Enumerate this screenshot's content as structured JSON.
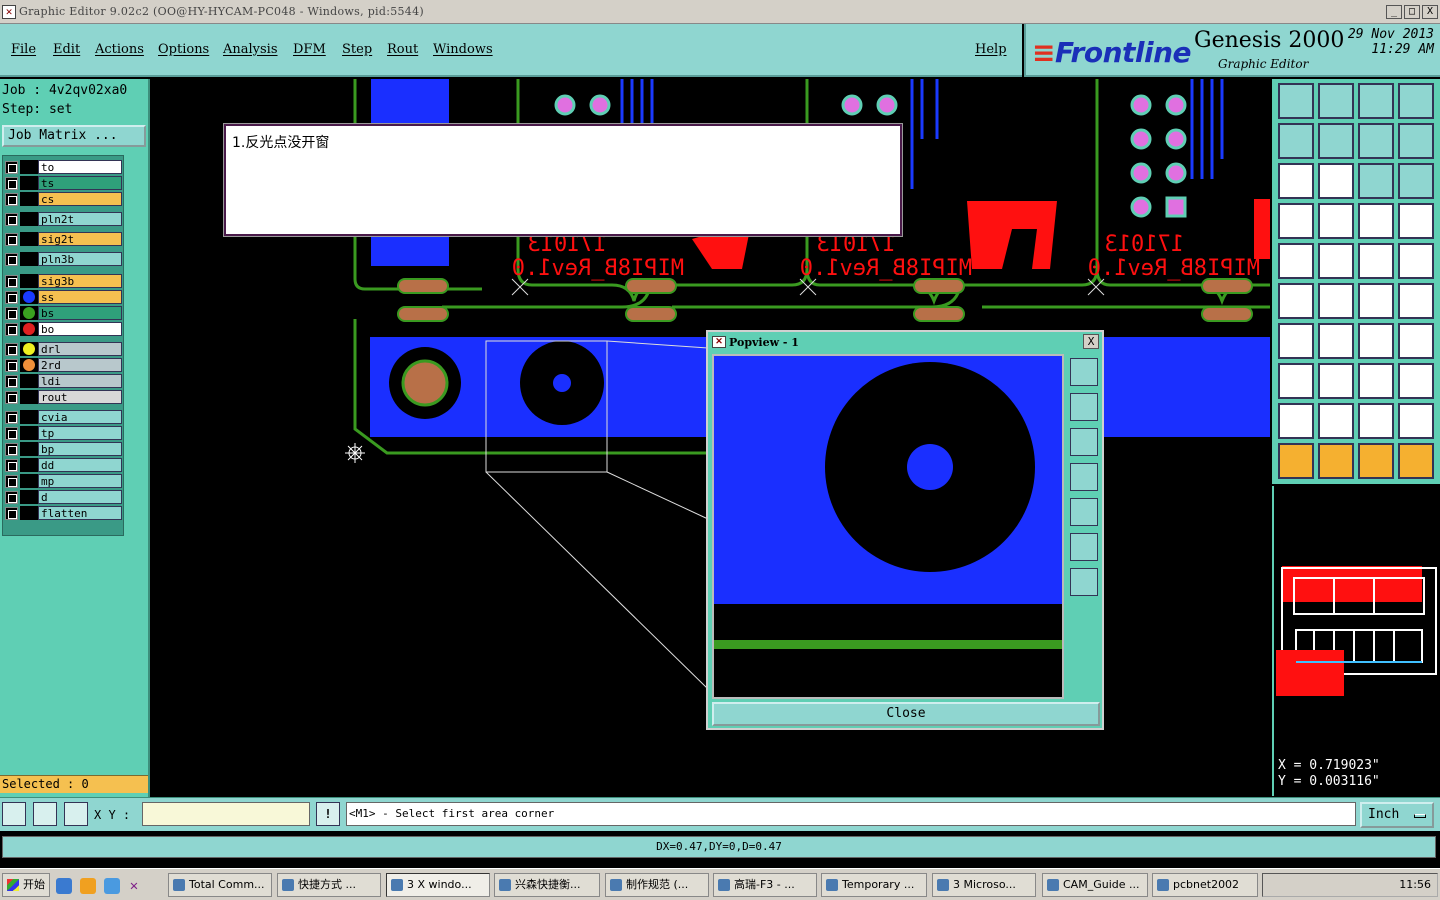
{
  "window": {
    "title": "Graphic Editor 9.02c2 (OO@HY-HYCAM-PC048 - Windows, pid:5544)",
    "minimize": "_",
    "maximize": "□",
    "close": "X"
  },
  "menu": {
    "file": "File",
    "edit": "Edit",
    "actions": "Actions",
    "options": "Options",
    "analysis": "Analysis",
    "dfm": "DFM",
    "step": "Step",
    "rout": "Rout",
    "windows": "Windows",
    "help": "Help"
  },
  "logo": {
    "brand": "Frontline",
    "product": "Genesis 2000",
    "subtitle": "Graphic Editor",
    "date": "29 Nov 2013",
    "time": "11:29 AM"
  },
  "job": {
    "job_line": "Job : 4v2qv02xa0",
    "step_line": "Step: set",
    "matrix_button": "Job Matrix ..."
  },
  "layers": [
    {
      "name": "to",
      "color": "#ffffff",
      "dot": ""
    },
    {
      "name": "ts",
      "color": "#2fa07a",
      "dot": ""
    },
    {
      "name": "cs",
      "color": "#f5c050",
      "dot": ""
    },
    {
      "name": "pln2t",
      "color": "#8fd6d0",
      "dot": ""
    },
    {
      "name": "sig2t",
      "color": "#f5c050",
      "dot": ""
    },
    {
      "name": "pln3b",
      "color": "#8fd6d0",
      "dot": ""
    },
    {
      "name": "sig3b",
      "color": "#f5c050",
      "dot": ""
    },
    {
      "name": "ss",
      "color": "#f5c050",
      "dot": "#1a3aff"
    },
    {
      "name": "bs",
      "color": "#2fa07a",
      "dot": "#3aa020"
    },
    {
      "name": "bo",
      "color": "#ffffff",
      "dot": "#e02020"
    },
    {
      "name": "drl",
      "color": "#b8c8cc",
      "dot": "#f0f020"
    },
    {
      "name": "2rd",
      "color": "#b8c8cc",
      "dot": "#f0903a"
    },
    {
      "name": "ldi",
      "color": "#b8c8cc",
      "dot": ""
    },
    {
      "name": "rout",
      "color": "#d8d8d8",
      "dot": ""
    },
    {
      "name": "cvia",
      "color": "#8fd6d0",
      "dot": ""
    },
    {
      "name": "tp",
      "color": "#8fd6d0",
      "dot": ""
    },
    {
      "name": "bp",
      "color": "#8fd6d0",
      "dot": ""
    },
    {
      "name": "dd",
      "color": "#8fd6d0",
      "dot": ""
    },
    {
      "name": "mp",
      "color": "#8fd6d0",
      "dot": ""
    },
    {
      "name": "d",
      "color": "#8fd6d0",
      "dot": ""
    },
    {
      "name": "flatten",
      "color": "#8fd6d0",
      "dot": ""
    }
  ],
  "selected": "Selected : 0",
  "canvas": {
    "board_texts": [
      "MIPI8B_Rev1.0",
      "MIPI8B_Rev1.0",
      "MIPI8B_Rev1.0"
    ],
    "date_codes": [
      "171013",
      "171013",
      "171013"
    ]
  },
  "note": {
    "text": "1.反光点没开窗"
  },
  "popview": {
    "title": "Popview - 1",
    "close_label": "Close",
    "close_x": "X"
  },
  "coords": {
    "x": "X = 0.719023\"",
    "y": "Y = 0.003116\""
  },
  "command": {
    "xy_label": "X Y :",
    "xy_value": "",
    "alert": "!",
    "prompt": "<M1> - Select first area corner",
    "unit": "Inch"
  },
  "status": "DX=0.47,DY=0,D=0.47",
  "taskbar": {
    "start": "开始",
    "tasks": [
      "Total Comm...",
      "快捷方式 ...",
      "3 X windo...",
      "兴森快捷衡...",
      "制作规范 (...",
      "高瑞-F3 - ...",
      "Temporary ...",
      "3 Microso...",
      "CAM_Guide ...",
      "pcbnet2002"
    ],
    "clock": "11:56"
  }
}
